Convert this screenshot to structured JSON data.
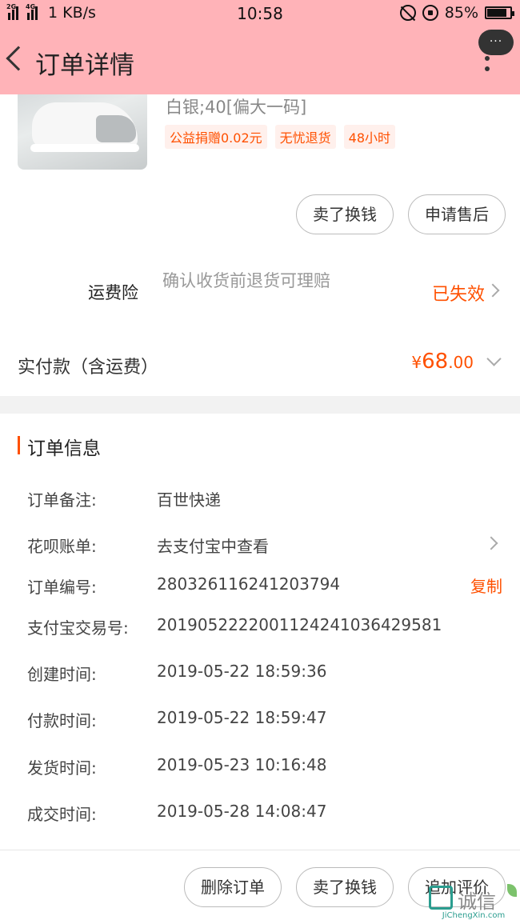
{
  "status_bar": {
    "net1": "2G",
    "net2": "4G",
    "speed": "1 KB/s",
    "time": "10:58",
    "battery": "85%"
  },
  "header": {
    "title": "订单详情",
    "more_bubble": "···"
  },
  "product": {
    "spec": "白银;40[偏大一码]",
    "tags": [
      "公益捐赠0.02元",
      "无忧退货",
      "48小时"
    ],
    "actions": [
      "卖了换钱",
      "申请售后"
    ]
  },
  "insurance": {
    "label": "运费险",
    "desc": "确认收货前退货可理赔",
    "status": "已失效"
  },
  "payment": {
    "label": "实付款（含运费）",
    "currency": "¥",
    "amount_int": "68",
    "amount_dec": ".00"
  },
  "order_info": {
    "title": "订单信息",
    "rows": [
      {
        "label": "订单备注:",
        "value": "百世快递"
      },
      {
        "label": "花呗账单:",
        "value": "去支付宝中查看"
      },
      {
        "label": "订单编号:",
        "value": "280326116241203794"
      },
      {
        "label": "支付宝交易号:",
        "value": "2019052222001124241036429581"
      },
      {
        "label": "创建时间:",
        "value": "2019-05-22 18:59:36"
      },
      {
        "label": "付款时间:",
        "value": "2019-05-22 18:59:47"
      },
      {
        "label": "发货时间:",
        "value": "2019-05-23 10:16:48"
      },
      {
        "label": "成交时间:",
        "value": "2019-05-28 14:08:47"
      }
    ],
    "copy_label": "复制"
  },
  "bottom_actions": [
    "删除订单",
    "卖了换钱",
    "追加评价"
  ],
  "watermark": {
    "text": "诚信",
    "sub": "JiChengXin.com"
  }
}
